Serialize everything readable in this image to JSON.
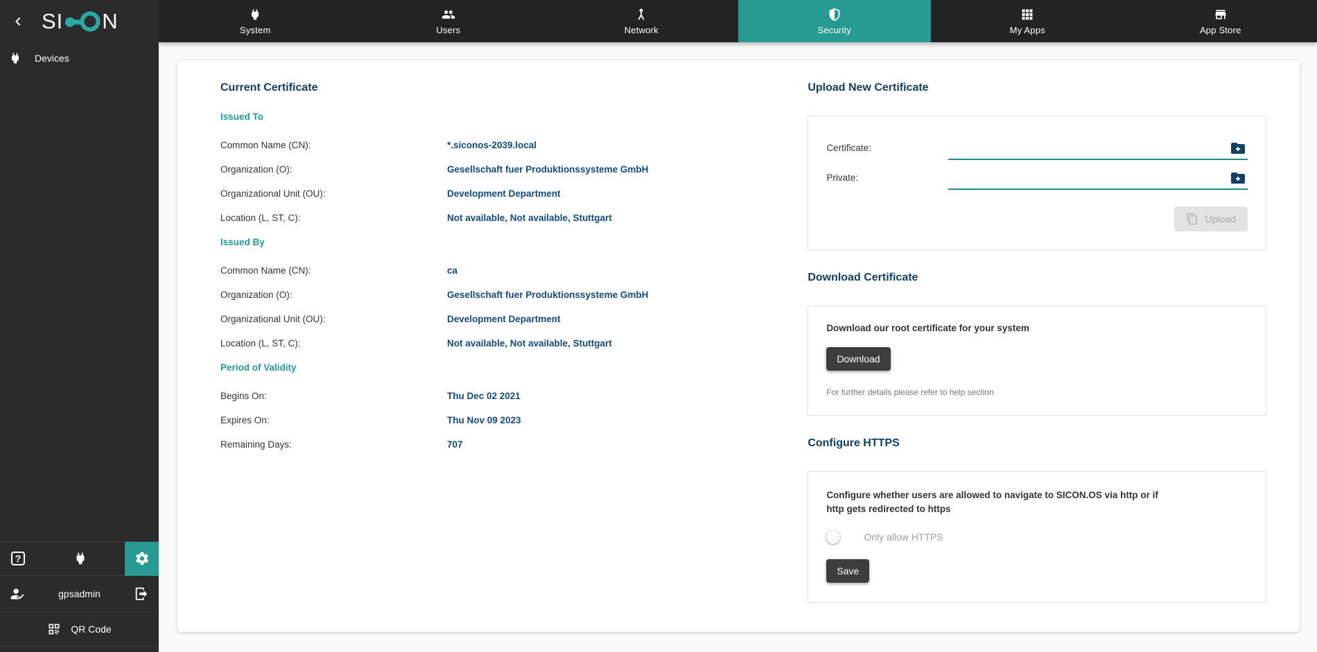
{
  "brand": {
    "logo_left": "SI",
    "logo_right": "N"
  },
  "colors": {
    "accent_teal": "#279a94",
    "heading_navy": "#123f63",
    "value_blue": "#114a7c",
    "topbar": "#232323",
    "sidebar": "#2b2b2b"
  },
  "nav": {
    "tabs": [
      {
        "label": "System",
        "icon": "plug-icon",
        "active": false
      },
      {
        "label": "Users",
        "icon": "users-icon",
        "active": false
      },
      {
        "label": "Network",
        "icon": "network-icon",
        "active": false
      },
      {
        "label": "Security",
        "icon": "shield-icon",
        "active": true
      },
      {
        "label": "My Apps",
        "icon": "grid-icon",
        "active": false
      },
      {
        "label": "App Store",
        "icon": "store-icon",
        "active": false
      }
    ]
  },
  "sidebar": {
    "devices_label": "Devices",
    "help_glyph": "?",
    "user_name": "gpsadmin",
    "qr_label": "QR Code"
  },
  "certificate": {
    "title": "Current Certificate",
    "issued_to": {
      "title": "Issued To",
      "rows": [
        {
          "label": "Common Name (CN):",
          "value": "*.siconos-2039.local"
        },
        {
          "label": "Organization (O):",
          "value": "Gesellschaft fuer Produktionssysteme GmbH"
        },
        {
          "label": "Organizational Unit (OU):",
          "value": "Development Department"
        },
        {
          "label": "Location (L, ST, C):",
          "value": "Not available, Not available, Stuttgart"
        }
      ]
    },
    "issued_by": {
      "title": "Issued By",
      "rows": [
        {
          "label": "Common Name (CN):",
          "value": "ca"
        },
        {
          "label": "Organization (O):",
          "value": "Gesellschaft fuer Produktionssysteme GmbH"
        },
        {
          "label": "Organizational Unit (OU):",
          "value": "Development Department"
        },
        {
          "label": "Location (L, ST, C):",
          "value": "Not available, Not available, Stuttgart"
        }
      ]
    },
    "validity": {
      "title": "Period of Validity",
      "rows": [
        {
          "label": "Begins On:",
          "value": "Thu Dec 02 2021"
        },
        {
          "label": "Expires On:",
          "value": "Thu Nov 09 2023"
        },
        {
          "label": "Remaining Days:",
          "value": "707"
        }
      ]
    }
  },
  "upload": {
    "title": "Upload New Certificate",
    "certificate_label": "Certificate:",
    "private_label": "Private:",
    "button_label": "Upload"
  },
  "download": {
    "title": "Download Certificate",
    "description": "Download our root certificate for your system",
    "button_label": "Download",
    "help_text": "For further details please refer to help section"
  },
  "https": {
    "title": "Configure HTTPS",
    "description": "Configure whether users are allowed to navigate to SICON.OS via http or if http gets redirected to https",
    "toggle_label": "Only allow HTTPS",
    "toggle_state": "off",
    "save_label": "Save"
  }
}
